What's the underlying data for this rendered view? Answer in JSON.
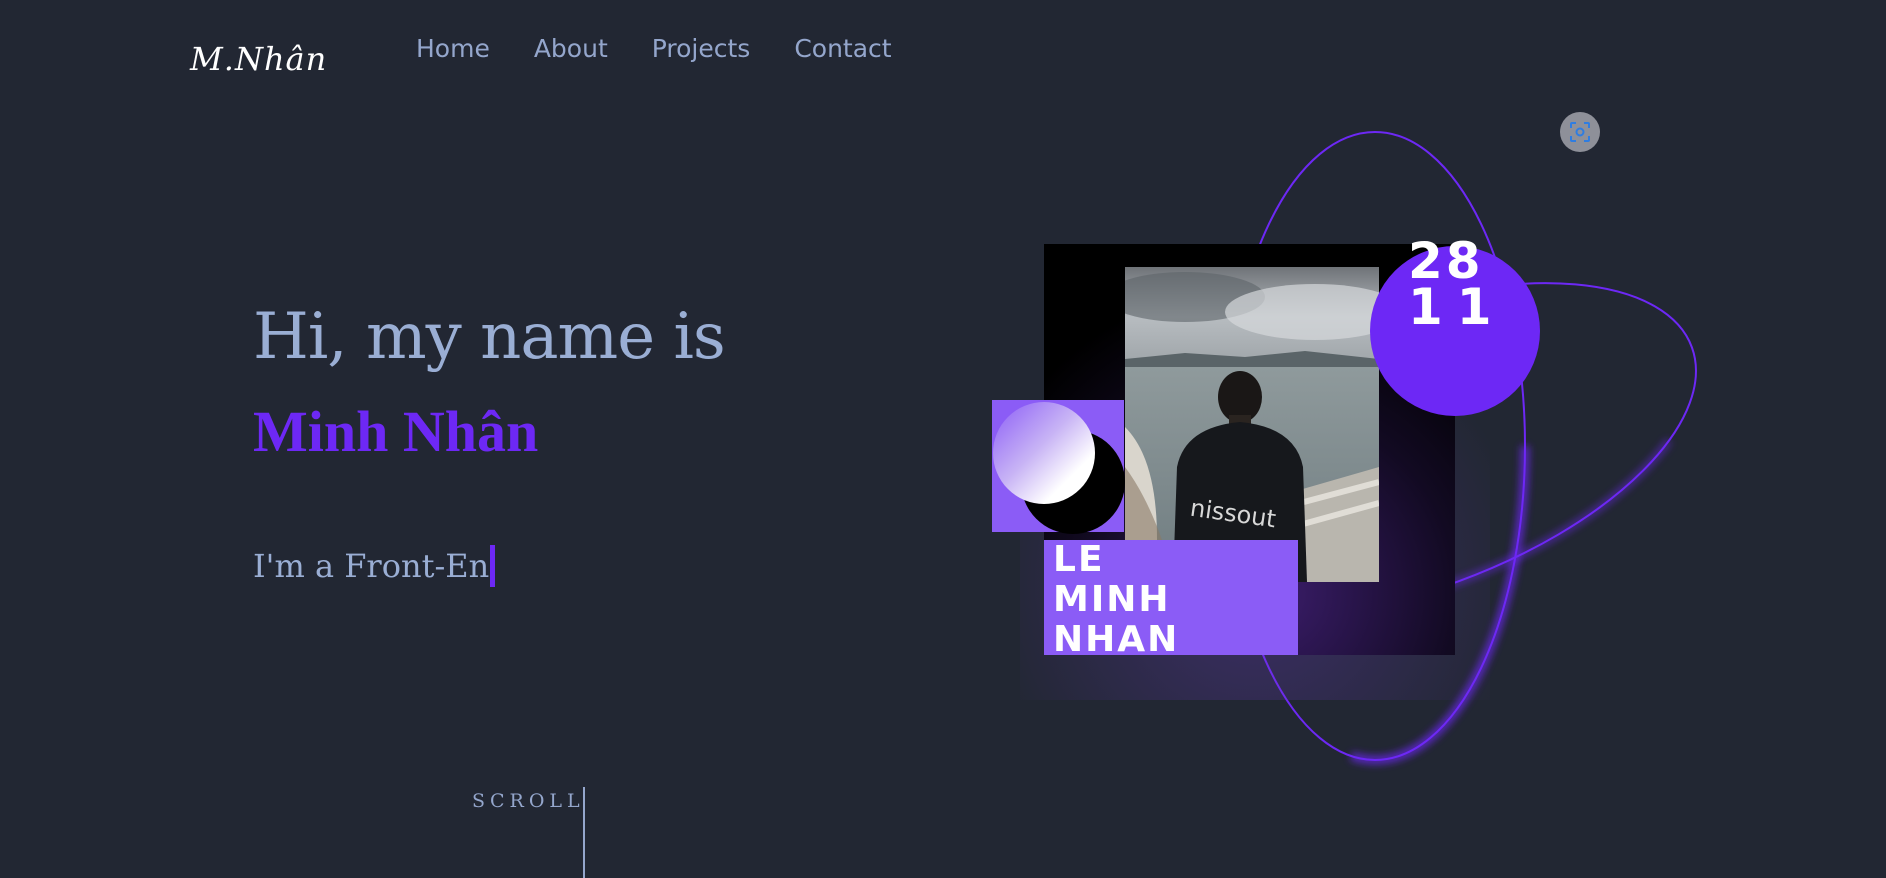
{
  "header": {
    "logo": "M.Nhân",
    "nav": [
      "Home",
      "About",
      "Projects",
      "Contact"
    ]
  },
  "hero": {
    "greeting": "Hi, my name is",
    "name": "Minh Nhân",
    "typing_text": "I'm a Front-En"
  },
  "scroll": {
    "label": "SCROLL"
  },
  "poster": {
    "date_line1": "28",
    "date_line2": "11",
    "name_line1": "LE",
    "name_line2": "MINH",
    "name_line3": "NHAN",
    "shirt_text": "nissout"
  },
  "colors": {
    "background": "#222733",
    "accent": "#6d28f5",
    "accent_light": "#8b5cf6",
    "text_muted": "#94a6cc"
  },
  "icons": {
    "screenshot_button": "screenshot-capture-icon"
  }
}
